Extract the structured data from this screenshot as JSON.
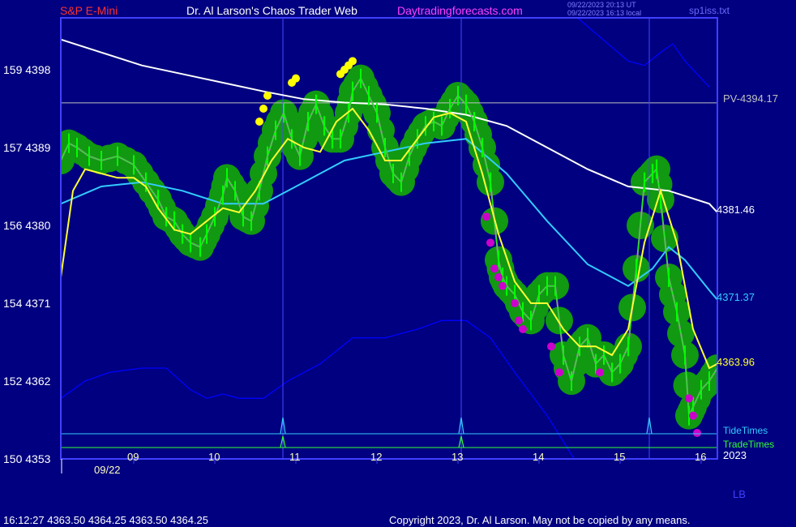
{
  "header": {
    "symbol": "S&P E-Mini",
    "title": "Dr. Al Larson's Chaos Trader Web",
    "site": "Daytradingforecasts.com",
    "time_ut": "09/22/2023 20:13 UT",
    "time_local": "09/22/2023 16:13 local",
    "file": "sp1iss.txt"
  },
  "axes": {
    "y_ticks": [
      "159  4398",
      "157  4389",
      "156  4380",
      "154  4371",
      "152  4362",
      "150  4353"
    ],
    "x_ticks": [
      "09",
      "10",
      "11",
      "12",
      "13",
      "14",
      "15",
      "16"
    ],
    "date_label": "09/22",
    "year_label": "2023",
    "lb_label": "LB"
  },
  "levels": {
    "pv": "PV-4394.17",
    "white_ma": "4381.46",
    "cyan_ma": "4371.37",
    "yellow_ma": "4363.96"
  },
  "legend": {
    "tide": "TideTimes",
    "trade": "TradeTimes"
  },
  "footer": {
    "quote": "16:12:27  4363.50 4364.25 4363.50 4364.25",
    "copyright": "Copyright 2023, Dr. Al Larson. May not be copied by any means."
  },
  "colors": {
    "background": "#000080",
    "frame": "#4040ff",
    "price": "#00ff00",
    "halo": "#119911",
    "white_ma": "#ffffff",
    "cyan_ma": "#33ccff",
    "yellow_ma": "#ffff33",
    "band": "#0000ff",
    "pv_line": "#c0c0c0",
    "mark_up": "#ffff00",
    "mark_down": "#cc00cc"
  },
  "chart_data": {
    "type": "line",
    "title": "S&P E-Mini",
    "x_unit": "hour",
    "y_unit": "price",
    "xlim": [
      8.0,
      16.1
    ],
    "ylim": [
      4353,
      4404
    ],
    "pv_level": 4394.17,
    "tide_times": [
      10.74,
      12.94,
      15.26
    ],
    "trade_times": [
      10.74,
      12.94
    ],
    "series": [
      {
        "name": "price",
        "x": [
          8.0,
          8.1,
          8.2,
          8.35,
          8.5,
          8.7,
          8.9,
          9.05,
          9.2,
          9.3,
          9.4,
          9.5,
          9.6,
          9.72,
          9.8,
          9.9,
          10.0,
          10.05,
          10.15,
          10.25,
          10.35,
          10.45,
          10.55,
          10.65,
          10.75,
          10.85,
          10.95,
          11.05,
          11.15,
          11.25,
          11.35,
          11.45,
          11.55,
          11.6,
          11.7,
          11.8,
          11.9,
          12.0,
          12.1,
          12.2,
          12.3,
          12.4,
          12.5,
          12.6,
          12.7,
          12.8,
          12.9,
          13.0,
          13.1,
          13.2,
          13.3,
          13.4,
          13.45,
          13.5,
          13.6,
          13.7,
          13.8,
          13.9,
          14.0,
          14.1,
          14.2,
          14.3,
          14.4,
          14.5,
          14.6,
          14.7,
          14.8,
          14.9,
          15.0,
          15.1,
          15.2,
          15.3,
          15.35,
          15.4,
          15.5,
          15.6,
          15.7,
          15.75,
          15.8,
          15.9,
          16.0,
          16.1
        ],
        "y": [
          4387.5,
          4389.5,
          4389,
          4388,
          4387.5,
          4388,
          4387,
          4385,
          4383,
          4381,
          4380.5,
          4379,
          4378,
          4377.5,
          4379,
          4381,
          4383.5,
          4385.5,
          4384,
          4381,
          4380.5,
          4384,
          4388,
          4391,
          4393,
          4390,
          4388,
          4392,
          4394,
          4391.5,
          4390,
          4390,
          4393,
          4395.5,
          4397,
          4395,
          4393,
          4389,
          4386,
          4385,
          4388,
          4390,
          4391.5,
          4392,
          4391.5,
          4393.5,
          4395,
          4394,
          4392,
          4389,
          4385,
          4376,
          4374,
          4373,
          4372,
          4370,
          4369,
          4372,
          4373,
          4373,
          4365,
          4362,
          4366,
          4367,
          4364,
          4365,
          4363,
          4364,
          4366,
          4375,
          4385,
          4386,
          4386.5,
          4383,
          4374,
          4370,
          4365,
          4358,
          4359,
          4361,
          4362,
          4363.5
        ]
      },
      {
        "name": "white",
        "x": [
          8.0,
          8.5,
          9.0,
          9.5,
          10.0,
          10.5,
          11.0,
          11.5,
          12.0,
          12.5,
          13.0,
          13.5,
          14.0,
          14.5,
          15.0,
          15.5,
          16.0,
          16.1
        ],
        "y": [
          4401.5,
          4400,
          4398.5,
          4397.5,
          4396.5,
          4395.5,
          4394.6,
          4394.2,
          4394,
          4393.5,
          4392.8,
          4391.5,
          4389,
          4386.5,
          4384.5,
          4384,
          4382.5,
          4381.5
        ]
      },
      {
        "name": "cyan",
        "x": [
          8.0,
          8.5,
          9.0,
          9.5,
          10.0,
          10.5,
          11.0,
          11.5,
          12.0,
          12.5,
          13.0,
          13.5,
          14.0,
          14.5,
          15.0,
          15.3,
          15.5,
          15.7,
          16.0,
          16.1
        ],
        "y": [
          4382.5,
          4384.5,
          4385,
          4384,
          4382.5,
          4382.5,
          4385,
          4387.5,
          4388.5,
          4389.5,
          4390,
          4386,
          4380.5,
          4375.5,
          4373,
          4375,
          4377.5,
          4376,
          4372.5,
          4371.4
        ]
      },
      {
        "name": "yellow",
        "x": [
          8.0,
          8.15,
          8.3,
          8.5,
          8.7,
          8.9,
          9.05,
          9.2,
          9.4,
          9.6,
          9.8,
          10.0,
          10.2,
          10.4,
          10.6,
          10.8,
          11.0,
          11.2,
          11.4,
          11.6,
          11.8,
          12.0,
          12.2,
          12.4,
          12.6,
          12.8,
          13.0,
          13.2,
          13.4,
          13.6,
          13.8,
          14.0,
          14.2,
          14.4,
          14.6,
          14.8,
          15.0,
          15.2,
          15.4,
          15.6,
          15.8,
          16.0,
          16.1
        ],
        "y": [
          4374,
          4384,
          4386.5,
          4386,
          4385.5,
          4385.5,
          4384.5,
          4382,
          4379.5,
          4379,
          4380.5,
          4382,
          4381.5,
          4384,
          4387.5,
          4390,
          4389,
          4388.5,
          4392,
          4393.5,
          4391,
          4387.5,
          4387.5,
          4390,
          4392.5,
          4393,
          4392,
          4386,
          4379,
          4373.5,
          4371,
          4371,
          4368,
          4366,
          4366,
          4365,
          4368,
          4378,
          4384,
          4378,
          4368,
          4363.5,
          4364
        ]
      },
      {
        "name": "band_upper",
        "x": [
          13.1,
          13.5,
          14.0,
          14.5,
          15.0,
          15.2,
          15.4,
          15.55,
          15.7,
          16.0
        ],
        "y": [
          4408,
          4408,
          4407,
          4403,
          4399,
          4398.5,
          4400,
          4401,
          4399,
          4396
        ]
      },
      {
        "name": "band_lower",
        "x": [
          8.0,
          8.3,
          8.6,
          9.0,
          9.3,
          9.6,
          9.8,
          10.0,
          10.2,
          10.5,
          10.8,
          11.2,
          11.6,
          12.0,
          12.4,
          12.7,
          13.0,
          13.3,
          13.6,
          14.0,
          14.4,
          14.8,
          15.2,
          15.6,
          16.0
        ],
        "y": [
          4360,
          4362,
          4363,
          4363.5,
          4363.5,
          4361,
          4360,
          4360.5,
          4360,
          4360,
          4362,
          4364,
          4367,
          4367,
          4368,
          4369,
          4369,
          4367,
          4363,
          4358,
          4352,
          4350,
          4351,
          4353,
          4352
        ]
      }
    ],
    "up_markers": [
      [
        10.45,
        4392
      ],
      [
        10.5,
        4393.5
      ],
      [
        10.55,
        4395
      ],
      [
        10.85,
        4396.5
      ],
      [
        10.9,
        4397
      ],
      [
        11.45,
        4397.5
      ],
      [
        11.5,
        4398
      ],
      [
        11.55,
        4398.5
      ],
      [
        11.6,
        4399
      ]
    ],
    "down_markers": [
      [
        13.25,
        4381
      ],
      [
        13.3,
        4378
      ],
      [
        13.35,
        4375
      ],
      [
        13.4,
        4374
      ],
      [
        13.45,
        4373
      ],
      [
        13.6,
        4371
      ],
      [
        13.65,
        4369
      ],
      [
        13.7,
        4368
      ],
      [
        14.05,
        4366
      ],
      [
        14.15,
        4363
      ],
      [
        14.65,
        4363
      ],
      [
        15.75,
        4360
      ],
      [
        15.8,
        4358
      ],
      [
        15.85,
        4356
      ]
    ]
  }
}
